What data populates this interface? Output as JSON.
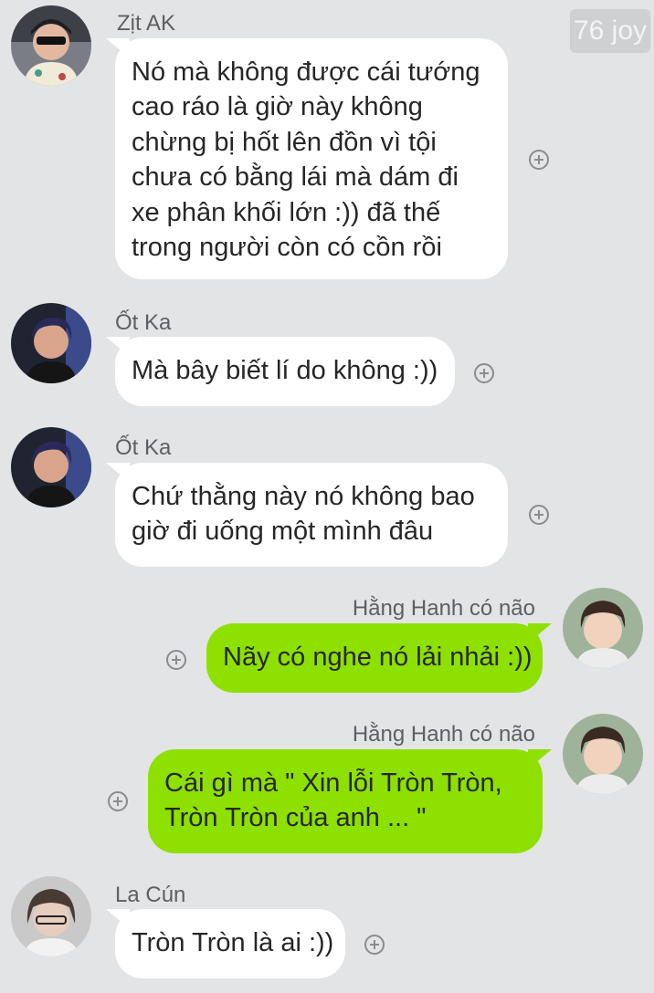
{
  "watermark": "76 joy",
  "messages": [
    {
      "sender": "Zịt AK",
      "side": "left",
      "avatar_icon": "user-avatar-icon",
      "lines": [
        "Nó mà không được cái tướng",
        "cao ráo là giờ này không",
        "chừng bị hốt lên đồn vì tội",
        "chưa có bằng lái mà dám đi",
        "xe phân khối lớn :)) đã thế",
        "trong người còn có cồn rồi"
      ]
    },
    {
      "sender": "Ốt Ka",
      "side": "left",
      "avatar_icon": "user-avatar-icon",
      "lines": [
        "Mà bây biết lí do không :))"
      ]
    },
    {
      "sender": "Ốt Ka",
      "side": "left",
      "avatar_icon": "user-avatar-icon",
      "lines": [
        "Chứ thằng này nó không bao",
        "giờ đi uống một mình đâu"
      ]
    },
    {
      "sender": "Hằng Hanh có não",
      "side": "right",
      "avatar_icon": "user-avatar-icon",
      "lines": [
        "Nãy có nghe nó lải nhải :))"
      ]
    },
    {
      "sender": "Hằng Hanh có não",
      "side": "right",
      "avatar_icon": "user-avatar-icon",
      "lines": [
        "Cái gì mà \" Xin lỗi Tròn Tròn,",
        "Tròn Tròn của anh ... \""
      ]
    },
    {
      "sender": "La Cún",
      "side": "left",
      "avatar_icon": "user-avatar-icon",
      "lines": [
        "Tròn Tròn là ai :))"
      ]
    }
  ],
  "reaction_icon": "add-reaction-icon",
  "colors": {
    "background": "#e3e4e6",
    "incoming_bubble": "#ffffff",
    "outgoing_bubble": "#8ee000",
    "sender_name": "#5c5f64"
  }
}
